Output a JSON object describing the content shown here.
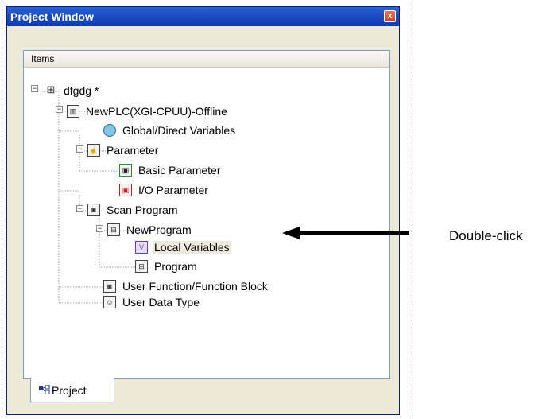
{
  "window": {
    "title": "Project Window",
    "close_glyph": "x"
  },
  "pane": {
    "header": "Items"
  },
  "tree": {
    "root": "dfgdg *",
    "plc": "NewPLC(XGI-CPUU)-Offline",
    "global_vars": "Global/Direct Variables",
    "parameter": "Parameter",
    "basic_param": "Basic Parameter",
    "io_param": "I/O Parameter",
    "scan_program": "Scan Program",
    "new_program": "NewProgram",
    "local_vars": "Local Variables",
    "program": "Program",
    "user_fb": "User Function/Function Block",
    "user_dt": "User Data Type"
  },
  "tabs": {
    "project": "Project"
  },
  "annotation": {
    "label": "Double-click"
  },
  "icons": {
    "root": "network-icon",
    "plc": "plc-icon",
    "global_vars": "globe-icon",
    "parameter": "hand-icon",
    "basic_param": "basic-param-icon",
    "io_param": "io-param-icon",
    "scan_program": "scan-program-icon",
    "new_program": "program-icon",
    "local_vars": "local-variables-icon",
    "program": "program-icon",
    "user_fb": "function-block-icon",
    "user_dt": "user-data-type-icon",
    "project_tab": "project-tab-icon"
  },
  "colors": {
    "title_bar": "#1c4cc2",
    "selection": "#efeadd",
    "window_bg": "#ece9d8"
  }
}
